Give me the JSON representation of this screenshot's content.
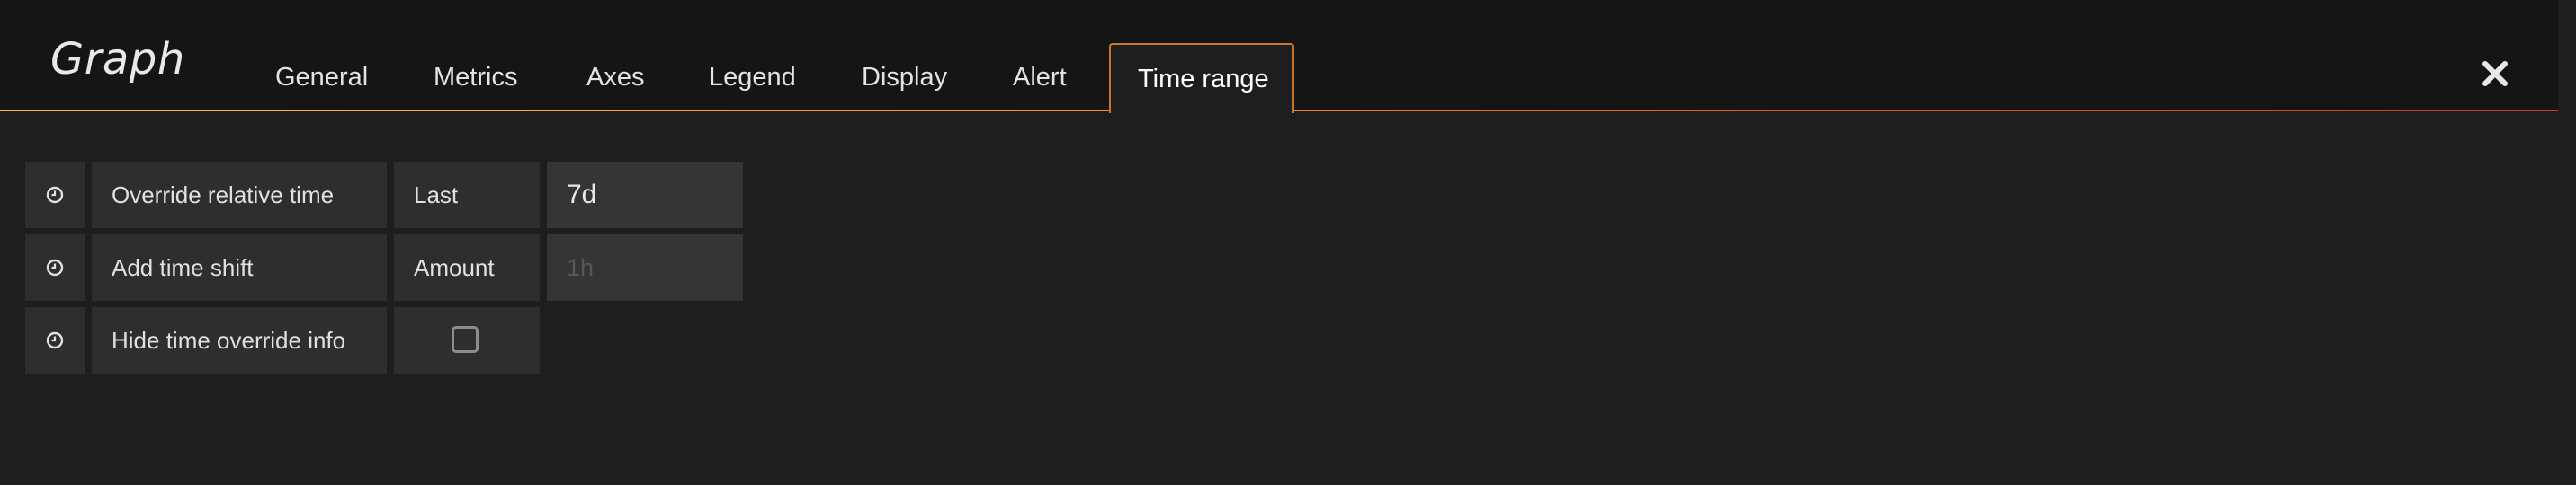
{
  "editor": {
    "title": "Graph",
    "close_icon": "close-icon",
    "tabs": [
      {
        "label": "General",
        "active": false
      },
      {
        "label": "Metrics",
        "active": false
      },
      {
        "label": "Axes",
        "active": false
      },
      {
        "label": "Legend",
        "active": false
      },
      {
        "label": "Display",
        "active": false
      },
      {
        "label": "Alert",
        "active": false
      },
      {
        "label": "Time range",
        "active": true
      }
    ]
  },
  "time_range": {
    "icon": "clock-icon",
    "override_relative_time": {
      "label": "Override relative time",
      "field_label": "Last",
      "value": "7d"
    },
    "add_time_shift": {
      "label": "Add time shift",
      "field_label": "Amount",
      "placeholder": "1h"
    },
    "hide_time_override_info": {
      "label": "Hide time override info",
      "checked": false
    }
  },
  "colors": {
    "background": "#1f1e1f",
    "header_background": "#151515",
    "accent_gradient_start": "#ffbb33",
    "accent_gradient_end": "#d23b29",
    "active_tab_border": "#c8752a",
    "field_background": "#2e2e2e",
    "input_background": "#353535"
  }
}
